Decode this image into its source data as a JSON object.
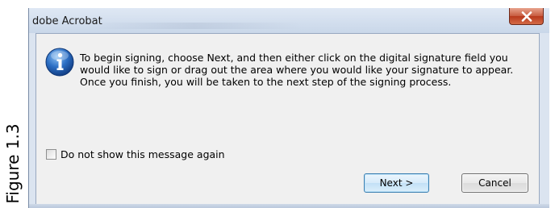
{
  "caption": {
    "text": "Figure 1.3"
  },
  "window": {
    "title": "dobe Acrobat",
    "close_icon": "close-x-icon"
  },
  "dialog": {
    "icon": "info-icon",
    "message": "To begin signing, choose Next, and then either click on the digital signature field you would like to sign or drag out the area where you would like your signature to appear. Once you finish, you will be taken to the next step of the signing process.",
    "checkbox": {
      "label": "Do not show this message again",
      "checked": false
    },
    "buttons": {
      "next_label": "Next >",
      "cancel_label": "Cancel"
    }
  },
  "colors": {
    "close_button": "#c75b3f",
    "info_icon": "#2c6fc4",
    "default_button_border": "#3c7fb1",
    "dialog_background": "#f0f0f0"
  }
}
